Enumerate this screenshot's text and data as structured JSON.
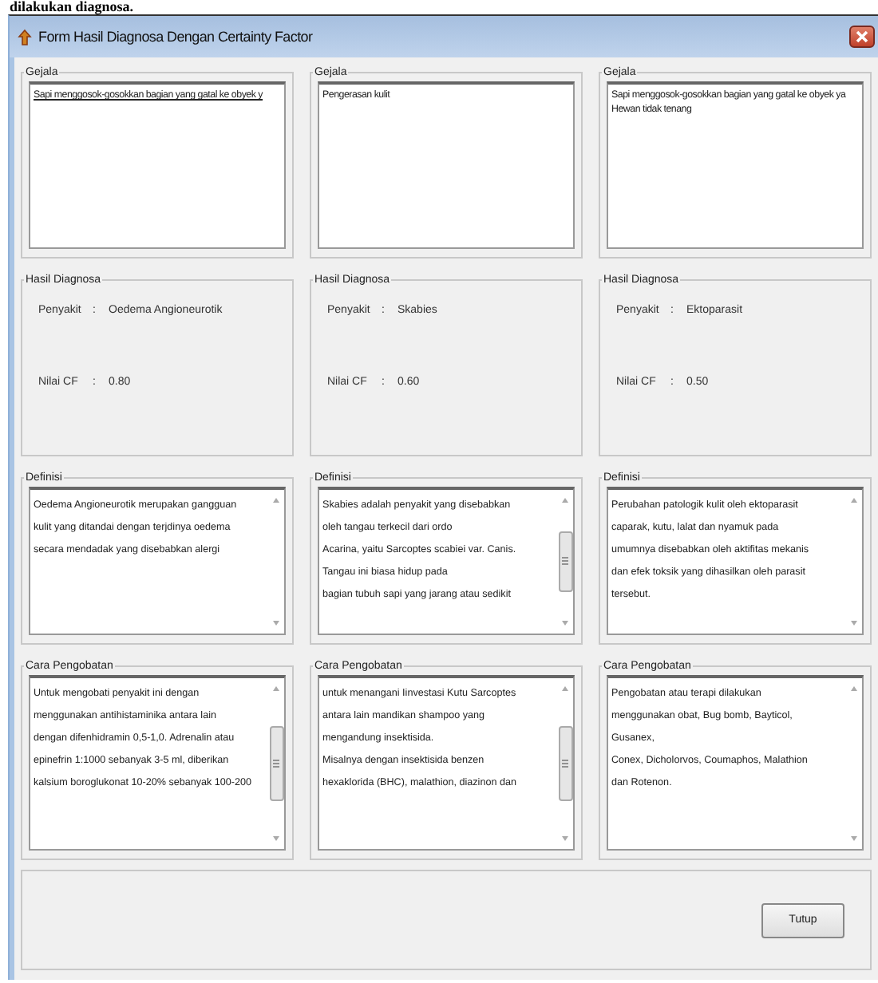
{
  "page_text": "dilakukan diagnosa.",
  "window": {
    "title": "Form Hasil Diagnosa Dengan Certainty Factor"
  },
  "columns": [
    {
      "gejala": {
        "label": "Gejala",
        "focused": true,
        "lines": [
          "Sapi menggosok-gosokkan bagian yang gatal ke obyek y"
        ]
      },
      "hasil": {
        "label": "Hasil Diagnosa",
        "rows": [
          {
            "name": "Penyakit",
            "colon": ":",
            "value": "Oedema Angioneurotik"
          },
          {
            "name": "Nilai CF",
            "colon": ":",
            "value": "0.80"
          }
        ]
      },
      "definisi": {
        "label": "Definisi",
        "scrollable": false,
        "lines": [
          "Oedema Angioneurotik merupakan gangguan",
          "kulit yang ditandai dengan terjdinya oedema",
          "secara mendadak yang disebabkan alergi"
        ]
      },
      "pengobatan": {
        "label": "Cara Pengobatan",
        "scrollable": true,
        "lines": [
          "Untuk mengobati penyakit ini dengan",
          "menggunakan antihistaminika antara lain",
          "dengan difenhidramin 0,5-1,0. Adrenalin atau",
          "epinefrin 1:1000 sebanyak 3-5 ml, diberikan",
          "kalsium boroglukonat 10-20% sebanyak 100-200"
        ]
      }
    },
    {
      "gejala": {
        "label": "Gejala",
        "focused": false,
        "lines": [
          "Pengerasan kulit"
        ]
      },
      "hasil": {
        "label": "Hasil Diagnosa",
        "rows": [
          {
            "name": "Penyakit",
            "colon": ":",
            "value": "Skabies"
          },
          {
            "name": "Nilai CF",
            "colon": ":",
            "value": "0.60"
          }
        ]
      },
      "definisi": {
        "label": "Definisi",
        "scrollable": true,
        "lines": [
          "Skabies adalah penyakit yang disebabkan",
          "oleh tangau terkecil dari ordo",
          "Acarina, yaitu Sarcoptes scabiei var. Canis.",
          "Tangau ini biasa hidup pada",
          "bagian tubuh sapi yang jarang atau sedikit"
        ]
      },
      "pengobatan": {
        "label": "Cara Pengobatan",
        "scrollable": true,
        "lines": [
          "untuk menangani Iinvestasi Kutu Sarcoptes",
          "antara lain mandikan shampoo yang",
          "mengandung insektisida.",
          "Misalnya dengan insektisida benzen",
          "hexaklorida (BHC), malathion, diazinon dan"
        ]
      }
    },
    {
      "gejala": {
        "label": "Gejala",
        "focused": false,
        "lines": [
          "Sapi menggosok-gosokkan bagian yang gatal ke obyek ya",
          "Hewan tidak tenang"
        ]
      },
      "hasil": {
        "label": "Hasil Diagnosa",
        "rows": [
          {
            "name": "Penyakit",
            "colon": ":",
            "value": "Ektoparasit"
          },
          {
            "name": "Nilai CF",
            "colon": ":",
            "value": "0.50"
          }
        ]
      },
      "definisi": {
        "label": "Definisi",
        "scrollable": false,
        "lines": [
          "Perubahan patologik kulit oleh ektoparasit",
          "caparak, kutu, lalat dan nyamuk pada",
          "umumnya disebabkan oleh aktifitas mekanis",
          "dan efek toksik yang dihasilkan oleh parasit",
          "tersebut."
        ]
      },
      "pengobatan": {
        "label": "Cara Pengobatan",
        "scrollable": false,
        "lines": [
          "Pengobatan atau terapi dilakukan",
          "menggunakan obat, Bug bomb, Bayticol,",
          "Gusanex,",
          "Conex, Dicholorvos, Coumaphos, Malathion",
          "dan Rotenon."
        ]
      }
    }
  ],
  "buttons": [
    {
      "label": "Tutup"
    }
  ]
}
